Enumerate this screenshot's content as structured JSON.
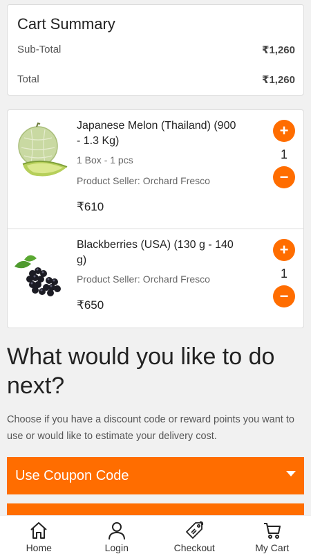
{
  "summary": {
    "title": "Cart Summary",
    "subtotal_label": "Sub-Total",
    "subtotal_value": "₹1,260",
    "total_label": "Total",
    "total_value": "₹1,260"
  },
  "products": [
    {
      "name": "Japanese Melon (Thailand) (900 - 1.3 Kg)",
      "pack": "1 Box - 1 pcs",
      "seller": "Product Seller: Orchard Fresco",
      "price": "₹610",
      "qty": "1",
      "image_icon": "melon-image"
    },
    {
      "name": "Blackberries (USA) (130 g - 140 g)",
      "seller": "Product Seller: Orchard Fresco",
      "price": "₹650",
      "qty": "1",
      "image_icon": "blackberries-image"
    }
  ],
  "next": {
    "heading": "What would you like to do next?",
    "description": "Choose if you have a discount code or reward points you want to use or would like to estimate your delivery cost.",
    "coupon_label": "Use Coupon Code"
  },
  "nav": {
    "home": "Home",
    "login": "Login",
    "checkout": "Checkout",
    "cart": "My Cart"
  },
  "colors": {
    "accent": "#ff6d00"
  }
}
